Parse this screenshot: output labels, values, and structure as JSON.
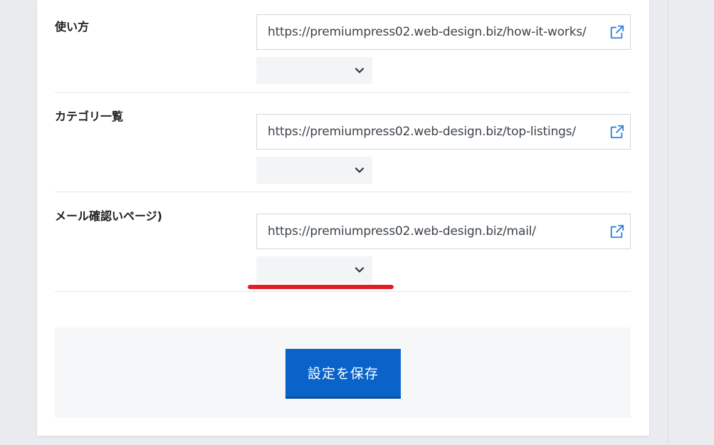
{
  "rows": [
    {
      "label": "使い方",
      "url": "https://premiumpress02.web-design.biz/how-it-works/",
      "select_value": ""
    },
    {
      "label": "カテゴリ一覧",
      "url": "https://premiumpress02.web-design.biz/top-listings/",
      "select_value": ""
    },
    {
      "label": "メール確認いページ)",
      "url": "https://premiumpress02.web-design.biz/mail/",
      "select_value": ""
    }
  ],
  "save_button_label": "設定を保存",
  "colors": {
    "accent": "#0a63c9",
    "annotation_red": "#e01e24",
    "link_icon": "#2f7fd8"
  },
  "icons": {
    "external_link": "external-link-icon",
    "dropdown": "chevron-down-icon"
  }
}
